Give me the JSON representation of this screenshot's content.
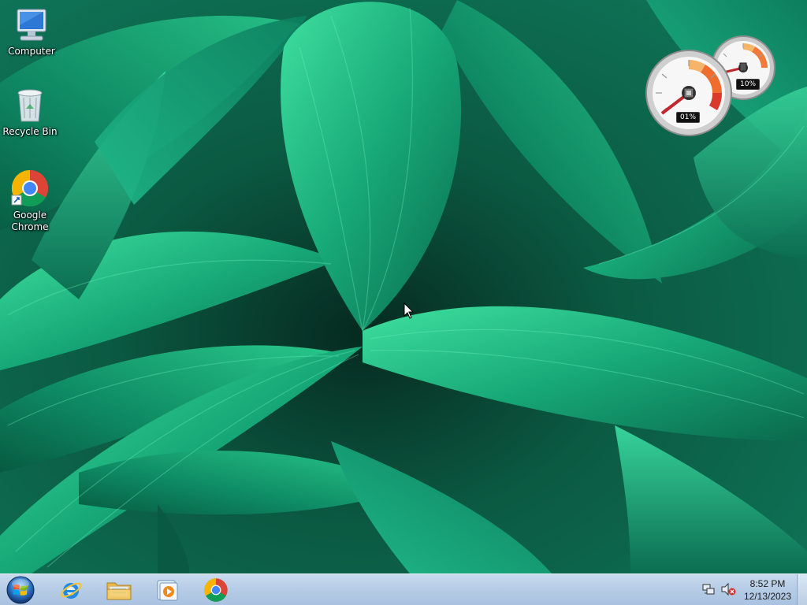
{
  "desktop": {
    "icons": [
      {
        "label": "Computer",
        "icon": "computer-icon"
      },
      {
        "label": "Recycle Bin",
        "icon": "recycle-bin-icon"
      },
      {
        "label": "Google Chrome",
        "label_line1": "Google",
        "label_line2": "Chrome",
        "icon": "chrome-icon"
      }
    ]
  },
  "gadgets": {
    "cpu_meter": {
      "cpu_readout": "01%",
      "memory_readout": "10%",
      "cpu_percent": 1,
      "memory_percent": 10
    }
  },
  "taskbar": {
    "start": {
      "icon": "windows-logo-icon"
    },
    "pinned": [
      {
        "name": "Internet Explorer",
        "icon": "internet-explorer-icon"
      },
      {
        "name": "Windows Explorer",
        "icon": "folder-icon"
      },
      {
        "name": "Windows Media Player",
        "icon": "media-player-icon"
      },
      {
        "name": "Google Chrome",
        "icon": "chrome-icon"
      }
    ],
    "tray": {
      "network_icon": "network-icon",
      "volume_icon": "volume-muted-icon",
      "time": "8:52 PM",
      "date": "12/13/2023"
    }
  },
  "colors": {
    "taskbar_top": "#c9dbee",
    "taskbar_bottom": "#a9c2e0",
    "wallpaper_base": "#0d6b4f",
    "leaf_light": "#2fcf8a"
  }
}
